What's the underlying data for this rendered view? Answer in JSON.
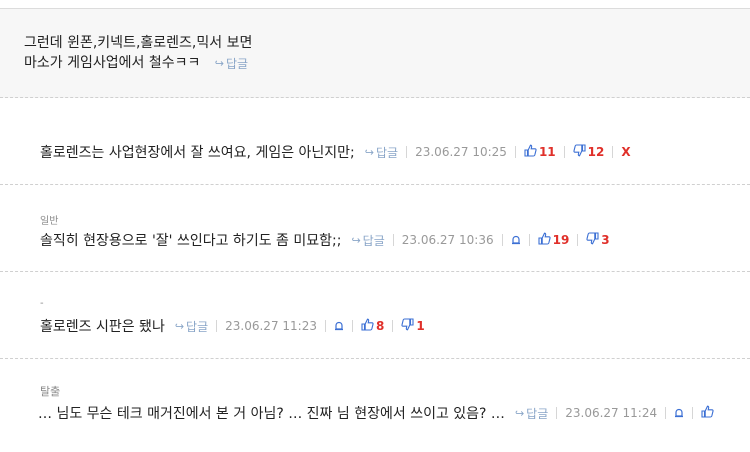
{
  "comments": [
    {
      "lines": [
        "그런데 윈폰,키넥트,홀로렌즈,믹서 보면",
        "마소가 게임사업에서 철수ㅋㅋ"
      ],
      "reply": "답글"
    },
    {
      "text": "홀로렌즈는 사업현장에서 잘 쓰여요, 게임은 아닌지만;",
      "reply": "답글",
      "date": "23.06.27 10:25",
      "up": "11",
      "down": "12",
      "delete": "X"
    },
    {
      "nick": "일반",
      "text": "솔직히 현장용으로 '잘' 쓰인다고 하기도 좀 미묘함;;",
      "reply": "답글",
      "date": "23.06.27 10:36",
      "up": "19",
      "down": "3"
    },
    {
      "nick": "-",
      "text": "홀로렌즈 시판은 됐나",
      "reply": "답글",
      "date": "23.06.27 11:23",
      "up": "8",
      "down": "1"
    },
    {
      "nick": "탈출",
      "text": "… 님도 무슨 테크 매거진에서 본 거 아님? … 진짜 님 현장에서 쓰이고 있음? …",
      "reply": "답글",
      "date": "23.06.27 11:24"
    }
  ],
  "icons": {
    "reply": "reply-arrow-icon",
    "up": "thumbs-up-icon",
    "down": "thumbs-down-icon",
    "report": "bell-icon"
  },
  "colors": {
    "reply": "#8aa6c8",
    "vote_icon": "#3b6fd4",
    "count": "#e0302a",
    "date": "#999999"
  }
}
